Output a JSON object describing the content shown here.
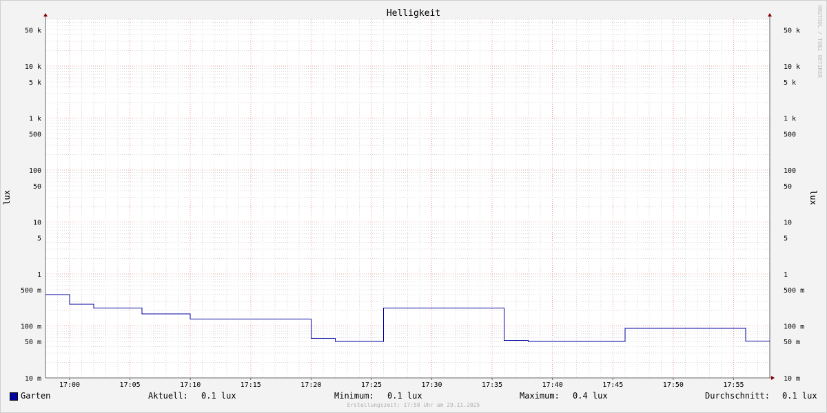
{
  "chart_data": {
    "type": "line",
    "title": "Helligkeit",
    "ylabel": "lux",
    "yscale": "log",
    "ylim": [
      0.01,
      80000
    ],
    "xlim": [
      "16:58",
      "17:58"
    ],
    "grid": true,
    "ytick_labels": [
      {
        "value": 50000,
        "label": "50 k"
      },
      {
        "value": 10000,
        "label": "10 k"
      },
      {
        "value": 5000,
        "label": "5 k"
      },
      {
        "value": 1000,
        "label": "1 k"
      },
      {
        "value": 500,
        "label": "500"
      },
      {
        "value": 100,
        "label": "100"
      },
      {
        "value": 50,
        "label": "50"
      },
      {
        "value": 10,
        "label": "10"
      },
      {
        "value": 5,
        "label": "5"
      },
      {
        "value": 1,
        "label": "1"
      },
      {
        "value": 0.5,
        "label": "500 m"
      },
      {
        "value": 0.1,
        "label": "100 m"
      },
      {
        "value": 0.05,
        "label": "50 m"
      },
      {
        "value": 0.01,
        "label": "10 m"
      }
    ],
    "xtick_labels": [
      "17:00",
      "17:05",
      "17:10",
      "17:15",
      "17:20",
      "17:25",
      "17:30",
      "17:35",
      "17:40",
      "17:45",
      "17:50",
      "17:55"
    ],
    "series": [
      {
        "name": "Garten",
        "color": "#0000a0",
        "step": true,
        "x": [
          "16:58",
          "17:00",
          "17:02",
          "17:06",
          "17:10",
          "17:20",
          "17:22",
          "17:26",
          "17:36",
          "17:38",
          "17:46",
          "17:56",
          "17:58"
        ],
        "values": [
          0.4,
          0.26,
          0.22,
          0.17,
          0.135,
          0.058,
          0.05,
          0.22,
          0.053,
          0.05,
          0.09,
          0.051,
          0.051
        ]
      }
    ]
  },
  "watermark": "RRDTOOL / TOBI OETIKER",
  "legend": {
    "series_name": "Garten",
    "swatch_color": "#0000a0",
    "current_label": "Aktuell:",
    "current_value": "0.1 lux",
    "min_label": "Minimum:",
    "min_value": "0.1 lux",
    "max_label": "Maximum:",
    "max_value": "0.4 lux",
    "avg_label": "Durchschnitt:",
    "avg_value": "0.1 lux"
  },
  "created_text": "Erstellungszeit: 17:58 Uhr am 29.11.2025"
}
